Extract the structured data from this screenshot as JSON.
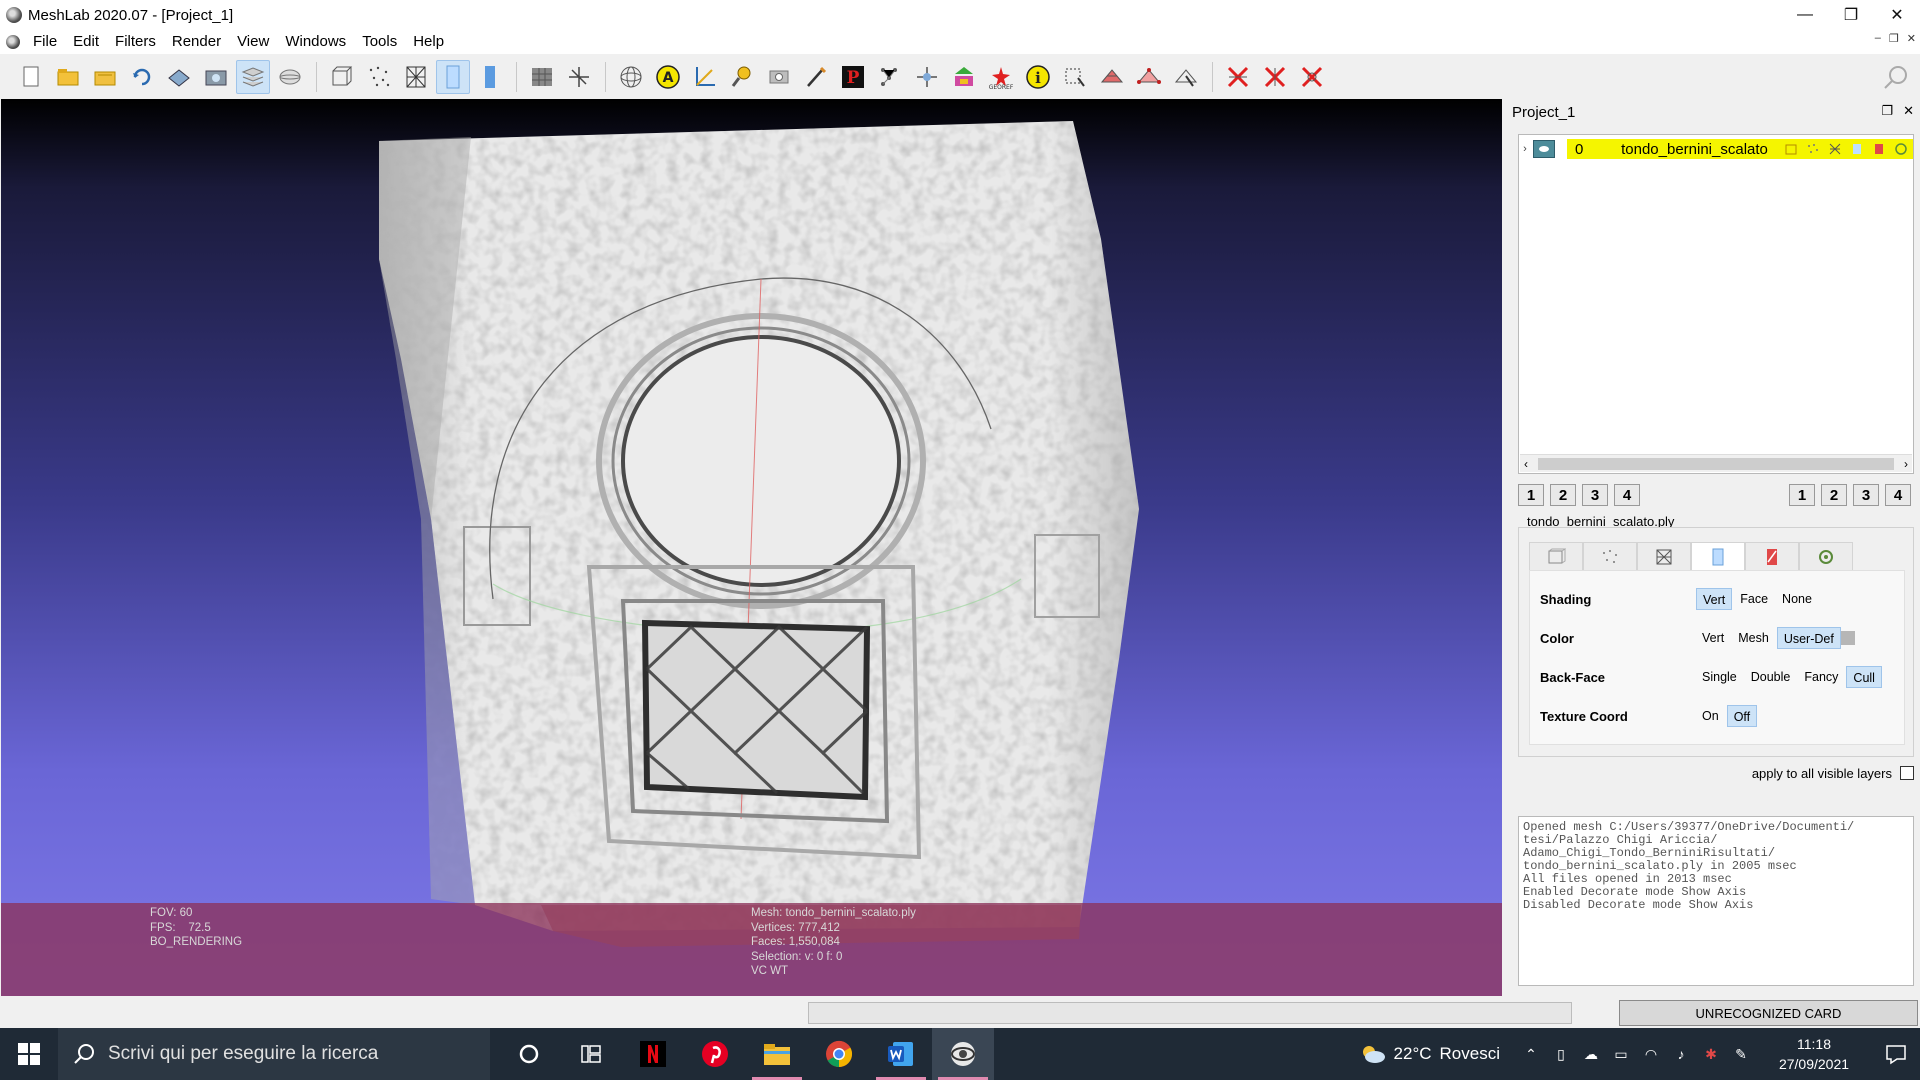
{
  "window": {
    "title": "MeshLab 2020.07 - [Project_1]",
    "buttons": {
      "minimize": "—",
      "maximize": "❐",
      "close": "✕"
    }
  },
  "menu": {
    "items": [
      "File",
      "Edit",
      "Filters",
      "Render",
      "View",
      "Windows",
      "Tools",
      "Help"
    ]
  },
  "toolbar": {
    "groups": [
      [
        "new-project-icon",
        "open-project-icon",
        "open-mesh-icon",
        "reload-icon",
        "save-icon",
        "snapshot-icon",
        "layers-icon",
        "spherical-icon"
      ],
      [
        "bounding-box-icon",
        "points-icon",
        "wireframe-icon",
        "flat-shading-icon",
        "smooth-shading-icon"
      ],
      [
        "texture-icon",
        "axis-icon"
      ],
      [
        "trackball-icon",
        "annotation-icon",
        "measure-icon",
        "paint-brush-icon",
        "camera-icon",
        "pen-icon",
        "pick-points-icon",
        "align-icon",
        "manipulator-icon",
        "color-paint-icon",
        "georef-icon",
        "info-icon",
        "select-area-icon",
        "select-faces-icon",
        "select-vertices-icon",
        "select-connected-icon"
      ],
      [
        "delete-vertices-icon",
        "delete-faces-icon",
        "delete-selection-icon"
      ]
    ],
    "active": [
      "layers-icon",
      "flat-shading-icon"
    ],
    "search_icon": "magnifier-icon"
  },
  "viewport": {
    "info_left": [
      "FOV: 60",
      "FPS:    72.5",
      "BO_RENDERING"
    ],
    "info_center": [
      "Mesh: tondo_bernini_scalato.ply",
      "Vertices: 777,412",
      "Faces: 1,550,084",
      "Selection: v: 0 f: 0",
      "VC WT"
    ]
  },
  "dock": {
    "title": "Project_1",
    "layer": {
      "number": "0",
      "name": "tondo_bernini_scalato"
    },
    "left_buttons": [
      "1",
      "2",
      "3",
      "4"
    ],
    "right_buttons": [
      "1",
      "2",
      "3",
      "4"
    ],
    "mesh_file": "tondo_bernini_scalato.ply",
    "render": {
      "shading": {
        "label": "Shading",
        "options": [
          "Vert",
          "Face",
          "None"
        ],
        "selected": "Vert"
      },
      "color": {
        "label": "Color",
        "options": [
          "Vert",
          "Mesh",
          "User-Def"
        ],
        "selected": "User-Def"
      },
      "backface": {
        "label": "Back-Face",
        "options": [
          "Single",
          "Double",
          "Fancy",
          "Cull"
        ],
        "selected": "Cull"
      },
      "texcoord": {
        "label": "Texture Coord",
        "options": [
          "On",
          "Off"
        ],
        "selected": "Off"
      }
    },
    "apply_all": "apply to all visible layers",
    "log": "Opened mesh C:/Users/39377/OneDrive/Documenti/\ntesi/Palazzo Chigi Ariccia/\nAdamo_Chigi_Tondo_BerniniRisultati/\ntondo_bernini_scalato.ply in 2005 msec\nAll files opened in 2013 msec\nEnabled Decorate mode Show Axis\nDisabled Decorate mode Show Axis"
  },
  "statusbar": {
    "card": "UNRECOGNIZED CARD"
  },
  "taskbar": {
    "search_placeholder": "Scrivi qui per eseguire la ricerca",
    "apps": [
      "cortana-icon",
      "task-view-icon",
      "netflix-icon",
      "pinterest-icon",
      "file-explorer-icon",
      "chrome-icon",
      "word-icon",
      "meshlab-icon"
    ],
    "weather": {
      "temp": "22°C",
      "desc": "Rovesci"
    },
    "clock": {
      "time": "11:18",
      "date": "27/09/2021"
    }
  }
}
